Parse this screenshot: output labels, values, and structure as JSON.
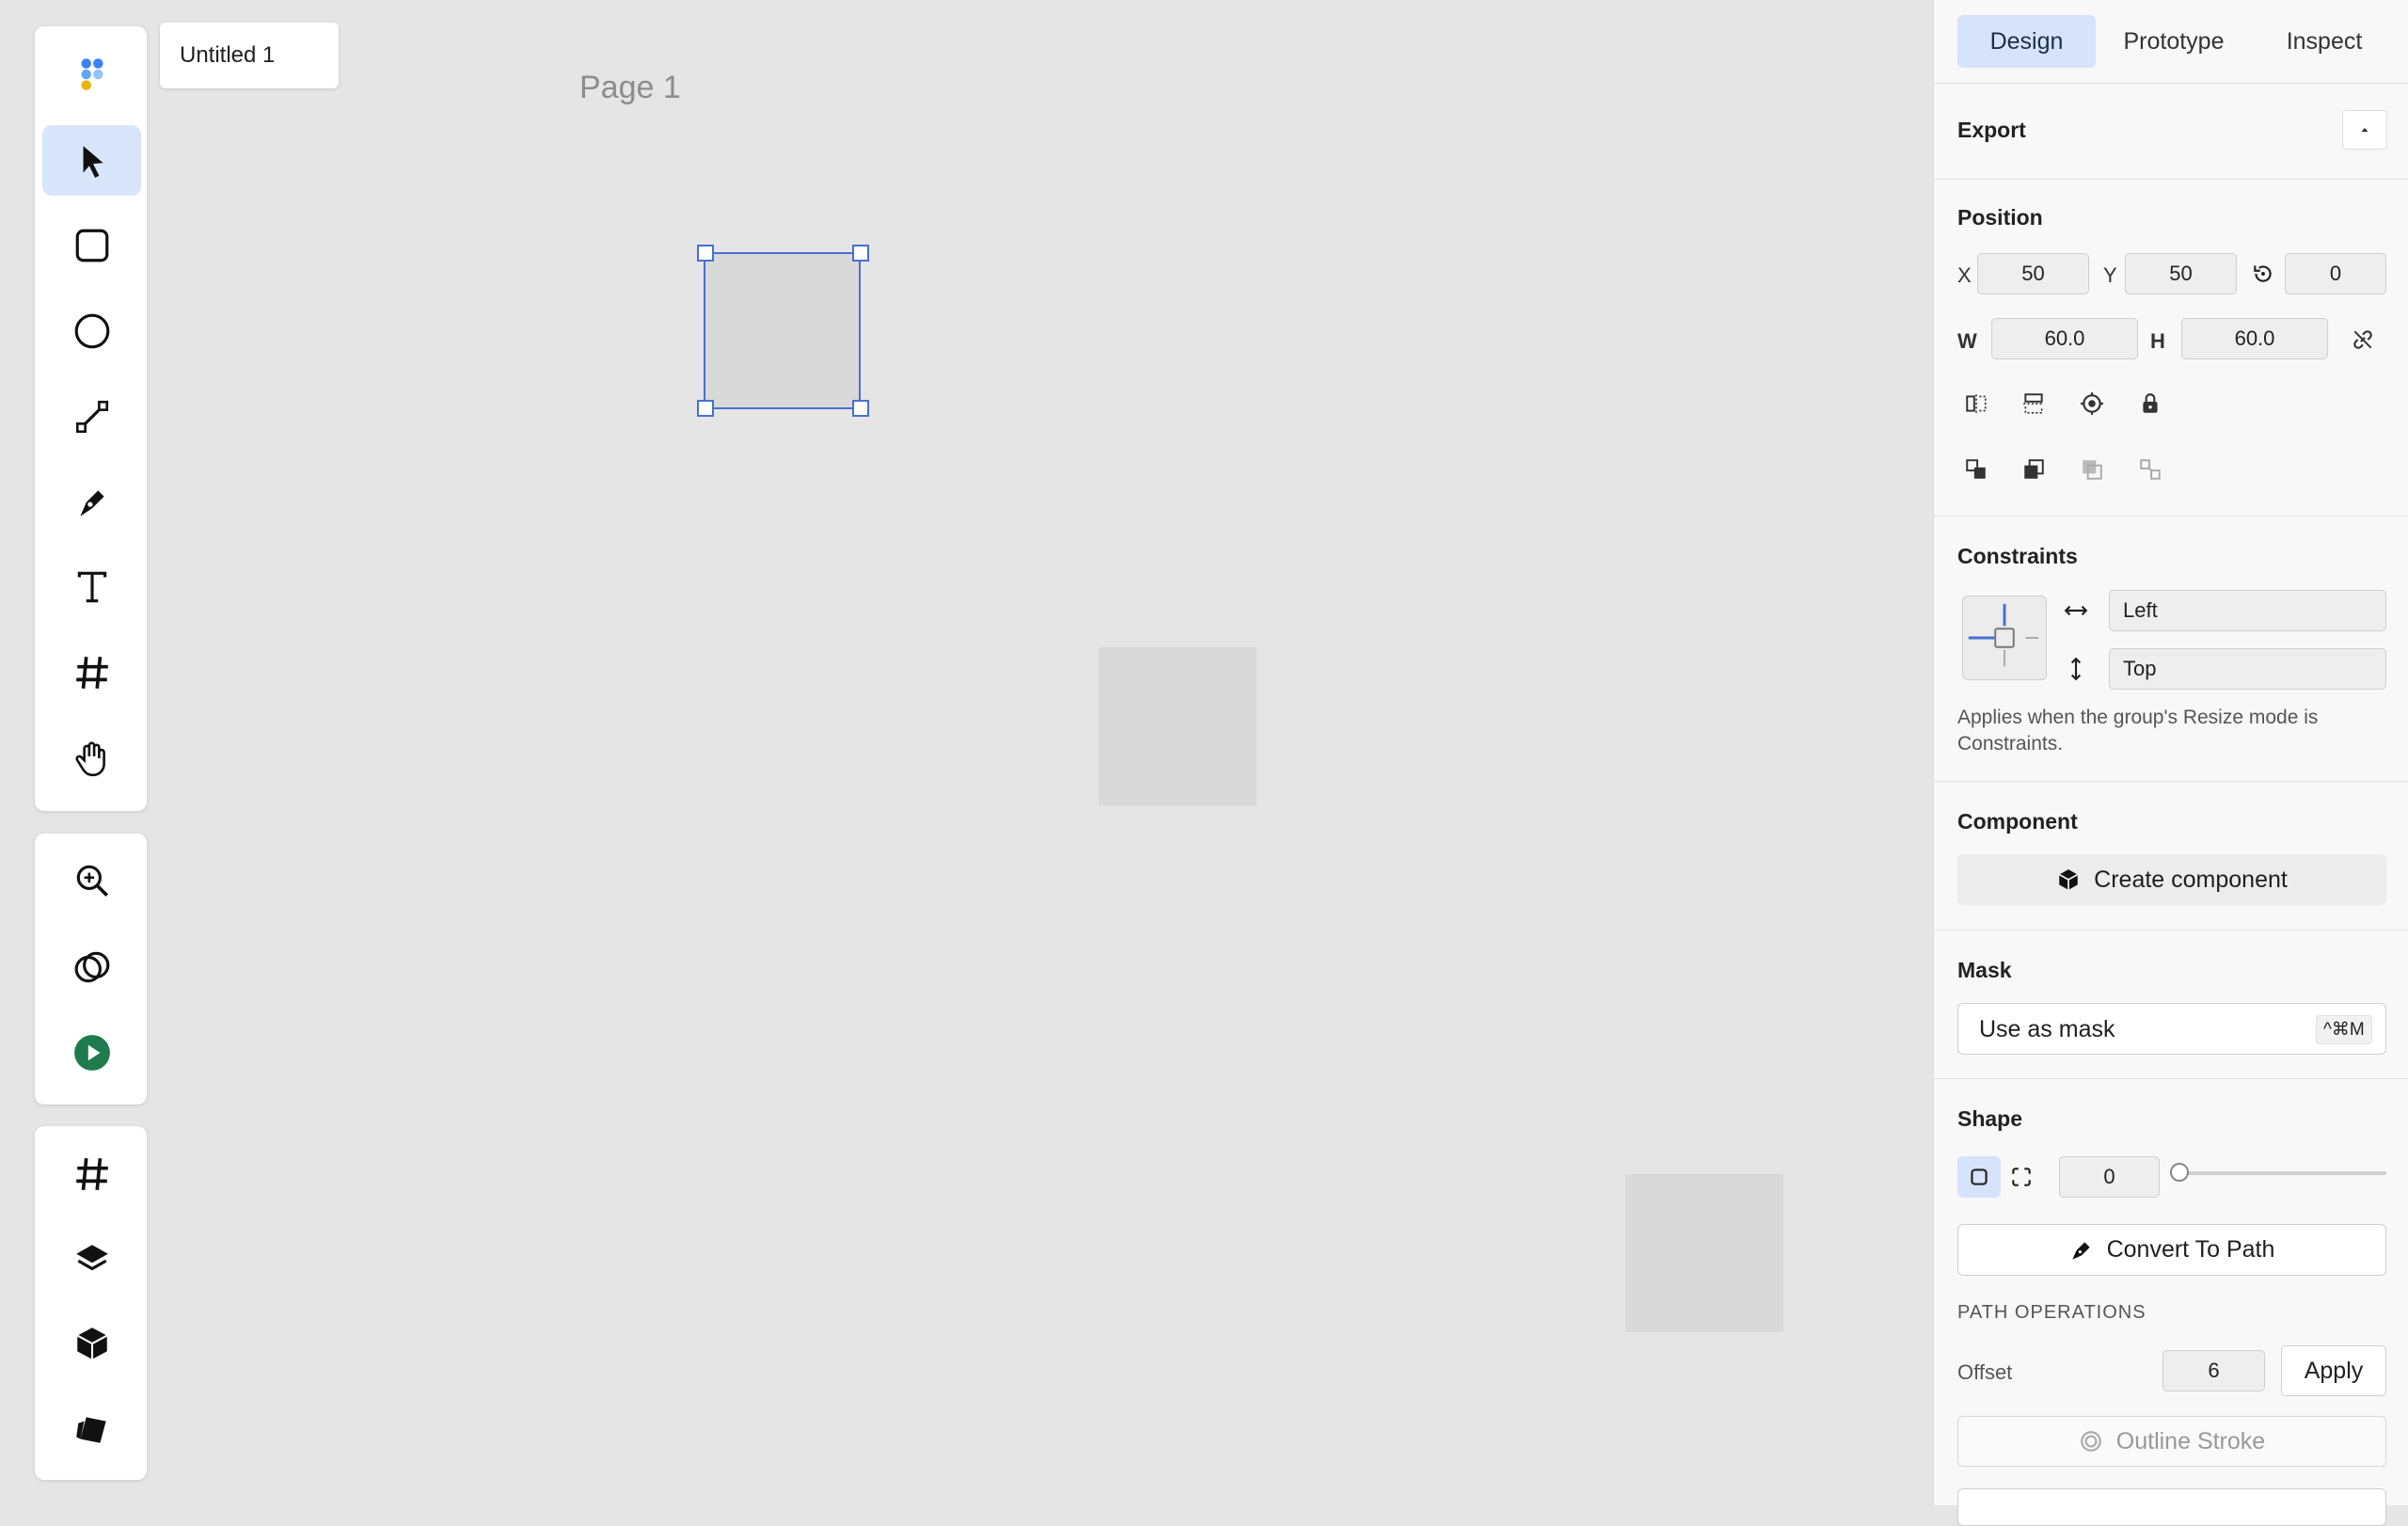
{
  "document": {
    "tab_name": "Untitled 1",
    "page_label": "Page 1"
  },
  "toolbar_main": [
    "logo-icon",
    "select-tool",
    "rectangle-tool",
    "ellipse-tool",
    "line-tool",
    "pen-tool",
    "text-tool",
    "frame-tool",
    "hand-tool"
  ],
  "toolbar_secondary": [
    "zoom-tool",
    "boolean-tool",
    "play-button"
  ],
  "toolbar_bottom": [
    "frames-button",
    "layers-button",
    "components-button",
    "assets-button"
  ],
  "panel": {
    "tabs": {
      "design": "Design",
      "prototype": "Prototype",
      "inspect": "Inspect",
      "active": "Design"
    },
    "export": {
      "title": "Export"
    },
    "position": {
      "title": "Position",
      "x_label": "X",
      "x": "50",
      "y_label": "Y",
      "y": "50",
      "rotation": "0",
      "w_label": "W",
      "w": "60.0",
      "h_label": "H",
      "h": "60.0"
    },
    "constraints": {
      "title": "Constraints",
      "horizontal": "Left",
      "vertical": "Top",
      "note": "Applies when the group's Resize mode is Constraints."
    },
    "component": {
      "title": "Component",
      "create_label": "Create component"
    },
    "mask": {
      "title": "Mask",
      "use_label": "Use as mask",
      "shortcut": "^⌘M"
    },
    "shape": {
      "title": "Shape",
      "corner_radius": "0",
      "radius_slider_value": 0,
      "convert_label": "Convert To Path",
      "path_ops_title": "PATH OPERATIONS",
      "offset_label": "Offset",
      "offset_value": "6",
      "apply_label": "Apply",
      "outline_label": "Outline Stroke"
    }
  },
  "colors": {
    "accent": "#4a6fd1",
    "active_tab": "#d6e3fa",
    "shape_fill": "#d9d9d9",
    "play": "#1f7a4d"
  }
}
